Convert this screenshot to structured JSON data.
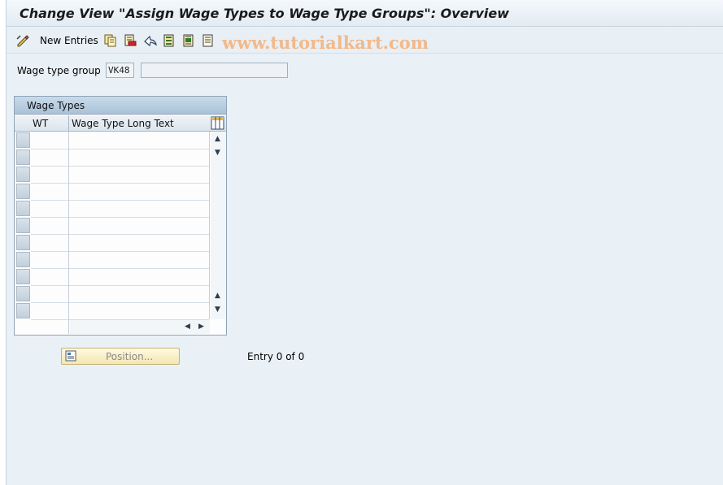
{
  "window": {
    "title": "Change View \"Assign Wage Types to Wage Type Groups\": Overview"
  },
  "toolbar": {
    "new_entries_label": "New Entries",
    "icons": [
      "change-icon",
      "copy-icon",
      "delete-icon",
      "undo-icon",
      "select-all-icon",
      "select-block-icon",
      "deselect-all-icon"
    ]
  },
  "watermark": {
    "text": "www.tutorialkart.com",
    "color": "#f2b98a"
  },
  "form": {
    "wage_type_group_label": "Wage type group",
    "wage_type_group_value": "VK48",
    "wage_type_group_description": ""
  },
  "table": {
    "title": "Wage Types",
    "columns": [
      "WT",
      "Wage Type Long Text"
    ],
    "visible_rows": 11,
    "rows": []
  },
  "footer": {
    "position_button_label": "Position...",
    "entry_text": "Entry 0 of 0"
  },
  "colors": {
    "background": "#eaf1f6",
    "table_header": "#a9c2d8",
    "button_bg": "#f4e7b3"
  }
}
